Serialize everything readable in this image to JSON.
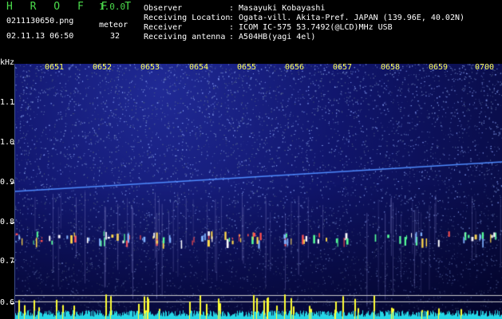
{
  "app": {
    "title": "H R O F F T",
    "version": "1.0.0"
  },
  "file": {
    "name": "0211130650.png",
    "timestamp": "02.11.13 06:50"
  },
  "meteor": {
    "label": "meteor",
    "count": "32"
  },
  "info": [
    {
      "label": "Observer",
      "value": ": Masayuki Kobayashi"
    },
    {
      "label": "Receiving Location",
      "value": ": Ogata-vill. Akita-Pref. JAPAN (139.96E, 40.02N)"
    },
    {
      "label": "Receiver",
      "value": ": ICOM IC-575 53.7492(@LCD)MHz USB"
    },
    {
      "label": "Receiving antenna",
      "value": ": A504HB(yagi 4el)"
    }
  ],
  "axis": {
    "unit": "kHz",
    "y_labels": [
      "1.1",
      "1.0",
      "0.9",
      "0.8",
      "0.7",
      "0.6"
    ],
    "x_labels": [
      "0651",
      "0652",
      "0653",
      "0654",
      "0655",
      "0656",
      "0657",
      "0658",
      "0659",
      "0700"
    ]
  },
  "colors": {
    "title_green": "#4bdc4b",
    "time_yellow": "#ffff55",
    "carrier_blue": "#4f8cff",
    "background": "#000000"
  }
}
